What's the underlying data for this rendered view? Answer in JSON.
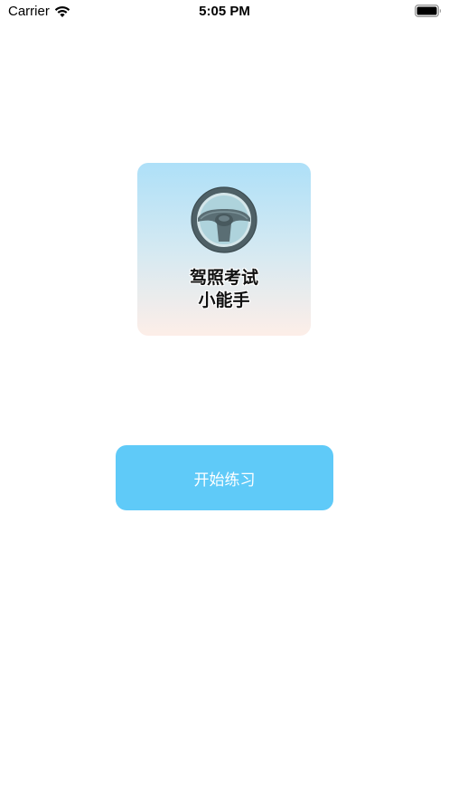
{
  "status_bar": {
    "carrier": "Carrier",
    "time": "5:05 PM",
    "wifi_icon": "wifi-icon",
    "battery_icon": "battery-full-icon"
  },
  "logo": {
    "icon": "steering-wheel-icon",
    "title_line1": "驾照考试",
    "title_line2": "小能手"
  },
  "start_button": {
    "label": "开始练习",
    "color": "#5fcaf8"
  },
  "colors": {
    "card_gradient_top": "#aee0f8",
    "card_gradient_bottom": "#fdeee8",
    "wheel": "#4e6066"
  }
}
